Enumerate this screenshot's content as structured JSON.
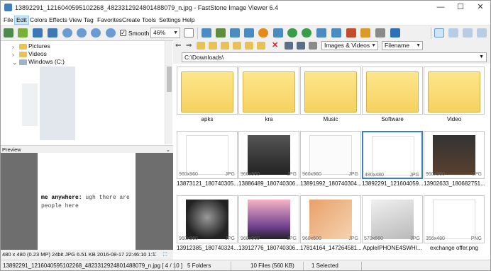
{
  "window": {
    "title": "13892291_1216040595102268_4823312924801488079_n.jpg - FastStone Image Viewer 6.4",
    "minimize": "—",
    "maximize": "☐",
    "close": "✕"
  },
  "menu": [
    "File",
    "Edit",
    "Colors",
    "Effects",
    "View",
    "Tag",
    "Favorites",
    "Create",
    "Tools",
    "Settings",
    "Help"
  ],
  "menu_selected": "Edit",
  "toolbar": {
    "smooth_label": "Smooth",
    "smooth_checked": true,
    "zoom_value": "46%"
  },
  "tree": {
    "items": [
      "Pictures",
      "Videos",
      "Windows (C:)"
    ]
  },
  "preview": {
    "header": "Preview",
    "text_bold": "me anywhere:",
    "text_rest": " ugh there are people here",
    "info": "480 x 480 (0.23 MP)  24bit  JPG  6.51 KB  2016-08-17 22:46:10  1:1"
  },
  "browser": {
    "filter_value": "Images & Videos",
    "sort_value": "Filename",
    "path": "C:\\Downloads\\"
  },
  "thumbnails": [
    {
      "caption": "apks",
      "kind": "folder"
    },
    {
      "caption": "kra",
      "kind": "folder"
    },
    {
      "caption": "Music",
      "kind": "folder"
    },
    {
      "caption": "Software",
      "kind": "folder"
    },
    {
      "caption": "Video",
      "kind": "folder"
    },
    {
      "caption": "13873121_180740305...",
      "dims": "960x960",
      "fmt": "JPG"
    },
    {
      "caption": "13886489_180740306...",
      "dims": "960x960",
      "fmt": "JPG"
    },
    {
      "caption": "13891992_180740304...",
      "dims": "960x960",
      "fmt": "JPG"
    },
    {
      "caption": "13892291_121604059...",
      "dims": "480x480",
      "fmt": "JPG"
    },
    {
      "caption": "13902633_180682751...",
      "dims": "960x960",
      "fmt": "JPG"
    },
    {
      "caption": "13912385_180740324...",
      "dims": "960x960",
      "fmt": "JPG"
    },
    {
      "caption": "13912776_180740306...",
      "dims": "960x960",
      "fmt": "JPG"
    },
    {
      "caption": "17814164_147264581...",
      "dims": "960x600",
      "fmt": "JPG"
    },
    {
      "caption": "AppleIPHONE4SWHI...",
      "dims": "570x660",
      "fmt": "JPG"
    },
    {
      "caption": "exchange offer.png",
      "dims": "356x480",
      "fmt": "PNG"
    }
  ],
  "status": {
    "file": "13892291_1216040595102268_4823312924801488079_n.jpg [ 4 / 10 ]",
    "folders": "5 Folders",
    "files": "10 Files (560 KB)",
    "selected": "1 Selected"
  },
  "colors": {
    "selection": "#3c7fc4",
    "folder": "#f6d160"
  }
}
